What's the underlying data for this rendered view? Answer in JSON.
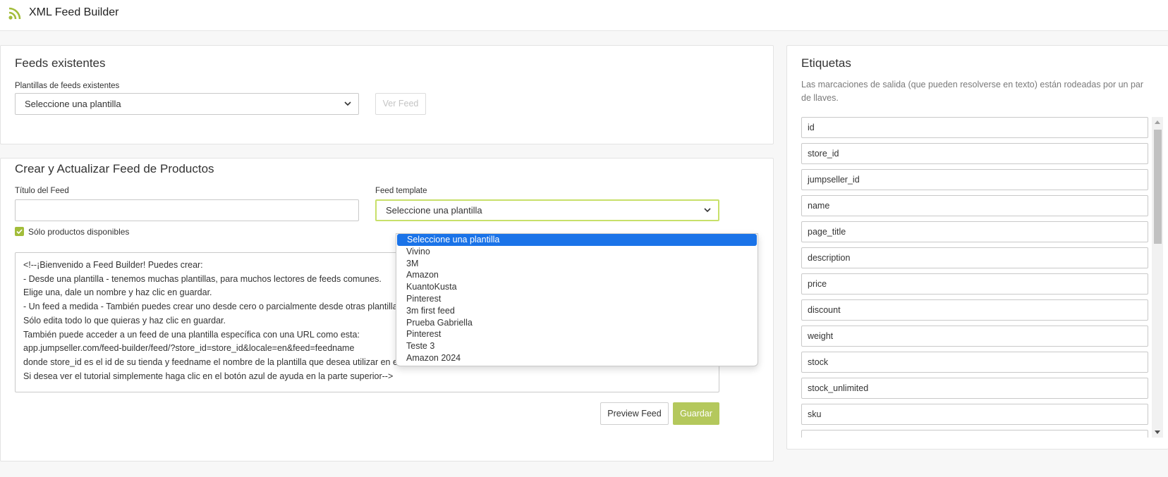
{
  "header": {
    "title": "XML Feed Builder",
    "icon": "rss-icon"
  },
  "feeds": {
    "title": "Feeds existentes",
    "select_label": "Plantillas de feeds existentes",
    "select_value": "Seleccione una plantilla",
    "view_button": "Ver Feed"
  },
  "create": {
    "title": "Crear y Actualizar Feed de Productos",
    "feed_title_label": "Título del Feed",
    "feed_title_value": "",
    "template_label": "Feed template",
    "template_value": "Seleccione una plantilla",
    "checkbox_label": "Sólo productos disponibles",
    "checkbox_checked": true,
    "textarea_lines": [
      "<!--¡Bienvenido a Feed Builder! Puedes crear:",
      "- Desde una plantilla - tenemos muchas plantillas, para muchos lectores de feeds comunes.",
      "Elige una, dale un nombre y haz clic en guardar.",
      "- Un feed a medida - También puedes crear uno desde cero o parcialmente desde otras plantillas.",
      "Sólo edita todo lo que quieras y haz clic en guardar.",
      "También puede acceder a un feed de una plantilla específica con una URL como esta:",
      "app.jumpseller.com/feed-builder/feed/?store_id=store_id&locale=en&feed=feedname",
      "donde store_id es el id de su tienda y feedname el nombre de la plantilla que desea utilizar en el feed.",
      "Si desea ver el tutorial simplemente haga clic en el botón azul de ayuda en la parte superior-->"
    ],
    "preview_button": "Preview Feed",
    "save_button": "Guardar",
    "dropdown_options": [
      "Seleccione una plantilla",
      "Vivino",
      "3M",
      "Amazon",
      "KuantoKusta",
      "Pinterest",
      "3m first feed",
      "Prueba Gabriella",
      "Pinterest",
      "Teste 3",
      "Amazon 2024"
    ],
    "dropdown_selected": "Seleccione una plantilla"
  },
  "tags": {
    "title": "Etiquetas",
    "description": "Las marcaciones de salida (que pueden resolverse en texto) están rodeadas por un par de llaves.",
    "items": [
      "id",
      "store_id",
      "jumpseller_id",
      "name",
      "page_title",
      "description",
      "price",
      "discount",
      "weight",
      "stock",
      "stock_unlimited",
      "sku",
      ""
    ]
  },
  "colors": {
    "accent_green": "#a2bd3a",
    "save_button": "#b4c85c",
    "selection_blue": "#1a73e8",
    "focus_border": "#c8e06a"
  }
}
